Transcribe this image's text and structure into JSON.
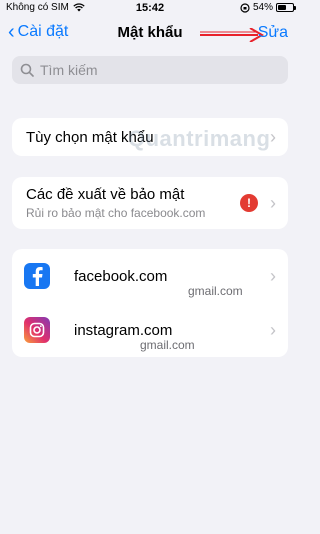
{
  "status_bar": {
    "carrier": "Không có SIM",
    "time": "15:42",
    "battery_percent": "54%",
    "battery_level": 0.54
  },
  "nav": {
    "back_label": "Cài đặt",
    "title": "Mật khẩu",
    "edit_label": "Sửa"
  },
  "search": {
    "placeholder": "Tìm kiếm"
  },
  "password_options": {
    "label": "Tùy chọn mật khẩu"
  },
  "security": {
    "title": "Các đề xuất về bảo mật",
    "subtitle": "Rủi ro bảo mật cho facebook.com",
    "alert_symbol": "!"
  },
  "accounts": [
    {
      "site": "facebook.com",
      "username": "gmail.com",
      "icon": "facebook-icon"
    },
    {
      "site": "instagram.com",
      "username": "gmail.com",
      "icon": "instagram-icon"
    }
  ],
  "watermark": "Quantrimang",
  "colors": {
    "accent": "#0a7aff",
    "alert": "#e33b32",
    "annotation_arrow": "#e8212b"
  }
}
